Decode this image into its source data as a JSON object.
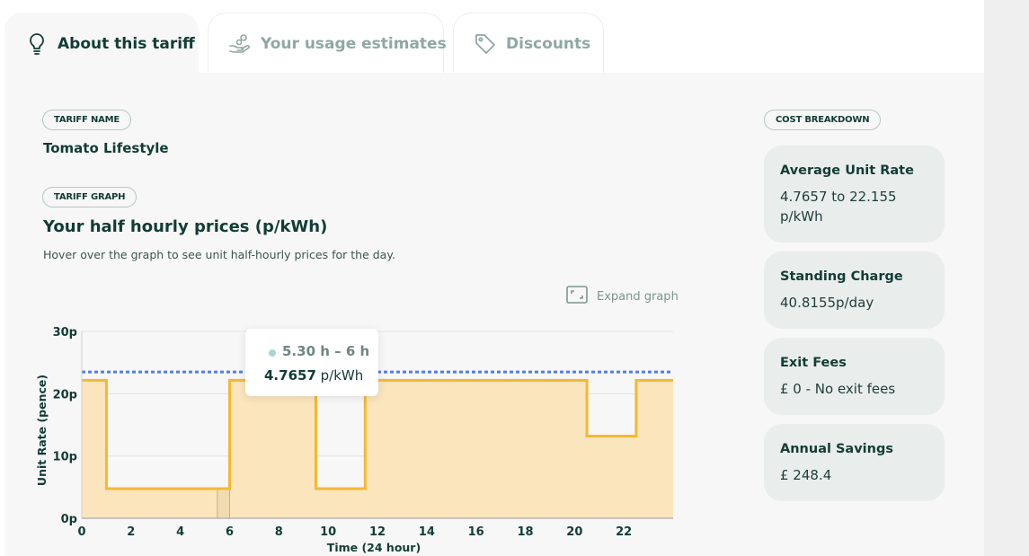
{
  "tabs": [
    {
      "label": "About this tariff",
      "icon": "lightbulb-icon",
      "active": true
    },
    {
      "label": "Your usage estimates",
      "icon": "hand-coins-icon",
      "active": false
    },
    {
      "label": "Discounts",
      "icon": "tag-icon",
      "active": false
    }
  ],
  "tariff": {
    "name_pill": "TARIFF NAME",
    "name": "Tomato Lifestyle",
    "graph_pill": "TARIFF GRAPH",
    "graph_title": "Your half hourly prices (p/kWh)",
    "graph_desc": "Hover over the graph to see unit half-hourly prices for the day.",
    "expand_label": "Expand graph"
  },
  "tooltip": {
    "time": "5.30 h – 6 h",
    "price_value": "4.7657",
    "price_unit": " p/kWh"
  },
  "cost": {
    "pill": "COST BREAKDOWN",
    "cards": [
      {
        "title": "Average Unit Rate",
        "value": "4.7657 to 22.155 p/kWh"
      },
      {
        "title": "Standing Charge",
        "value": "40.8155p/day"
      },
      {
        "title": "Exit Fees",
        "value": "£ 0 - No exit fees"
      },
      {
        "title": "Annual Savings",
        "value": "£ 248.4"
      }
    ]
  },
  "colors": {
    "price_line": "#f7b733",
    "price_fill": "#fae5bd",
    "average_line": "#4f7ee8",
    "text_dark": "#123c36"
  },
  "chart_data": {
    "type": "area",
    "xlabel": "Time (24 hour)",
    "ylabel": "Unit Rate (pence)",
    "x_ticks": [
      0,
      2,
      4,
      6,
      8,
      10,
      12,
      14,
      16,
      18,
      20,
      22
    ],
    "y_ticks": [
      "0p",
      "10p",
      "20p",
      "30p"
    ],
    "y_tick_values": [
      0,
      10,
      20,
      30
    ],
    "xlim": [
      0,
      24
    ],
    "ylim": [
      0,
      30
    ],
    "step": "post",
    "series": [
      {
        "x": [
          0,
          1,
          5.5,
          6,
          9.5,
          11.5,
          20.5,
          22.5,
          24
        ],
        "y": [
          22.155,
          4.7657,
          4.7657,
          22.155,
          4.7657,
          22.155,
          13.2,
          22.155,
          22.155
        ]
      }
    ],
    "reference_line": {
      "y": 23.5,
      "style": "dashed"
    },
    "highlight": {
      "x0": 5.5,
      "x1": 6,
      "y": 4.7657
    },
    "grid": true
  }
}
